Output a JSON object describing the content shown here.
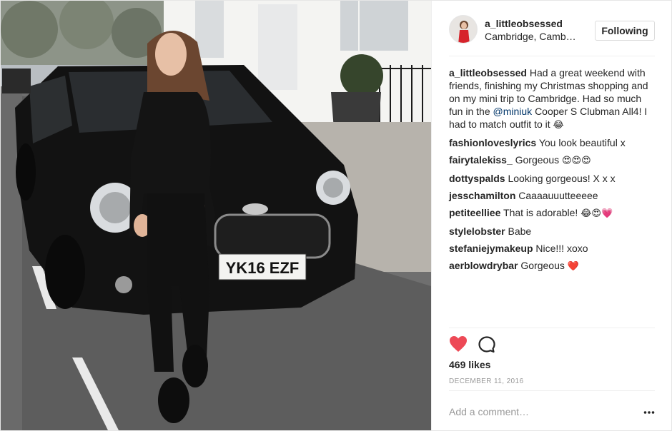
{
  "post": {
    "photo_icon": "photo-of-woman-and-black-mini-car",
    "plate": "YK16 EZF"
  },
  "header": {
    "username": "a_littleobsessed",
    "location": "Cambridge, Camb…",
    "follow_label": "Following"
  },
  "caption": {
    "user": "a_littleobsessed",
    "text_before": "Had a great weekend with friends, finishing my Christmas shopping and on my mini trip to Cambridge. Had so much fun in the",
    "mention": "@miniuk",
    "text_after": "Cooper S Clubman All4! I had to match outfit to it",
    "emoji": "😂"
  },
  "comments": [
    {
      "user": "fashionloveslyrics",
      "text": "You look beautiful x",
      "emoji": ""
    },
    {
      "user": "fairytalekiss_",
      "text": "Gorgeous",
      "emoji": "😍😍😍"
    },
    {
      "user": "dottyspalds",
      "text": "Looking gorgeous! X x x",
      "emoji": ""
    },
    {
      "user": "jesschamilton",
      "text": "Caaaauuutteeeee",
      "emoji": ""
    },
    {
      "user": "petiteelliee",
      "text": "That is adorable!",
      "emoji": "😂😍💗"
    },
    {
      "user": "stylelobster",
      "text": "Babe",
      "emoji": ""
    },
    {
      "user": "stefaniejymakeup",
      "text": "Nice!!! xoxo",
      "emoji": ""
    },
    {
      "user": "aerblowdrybar",
      "text": "Gorgeous",
      "emoji": "❤️"
    }
  ],
  "actions": {
    "heart_icon": "heart-icon",
    "comment_icon": "comment-bubble-icon",
    "liked": true,
    "heart_color": "#ed4956"
  },
  "likes": "469 likes",
  "date": "DECEMBER 11, 2016",
  "add_comment": {
    "placeholder": "Add a comment…",
    "more_icon": "more-options-icon"
  },
  "colors": {
    "mention": "#003569",
    "muted": "#999999",
    "text": "#262626"
  }
}
